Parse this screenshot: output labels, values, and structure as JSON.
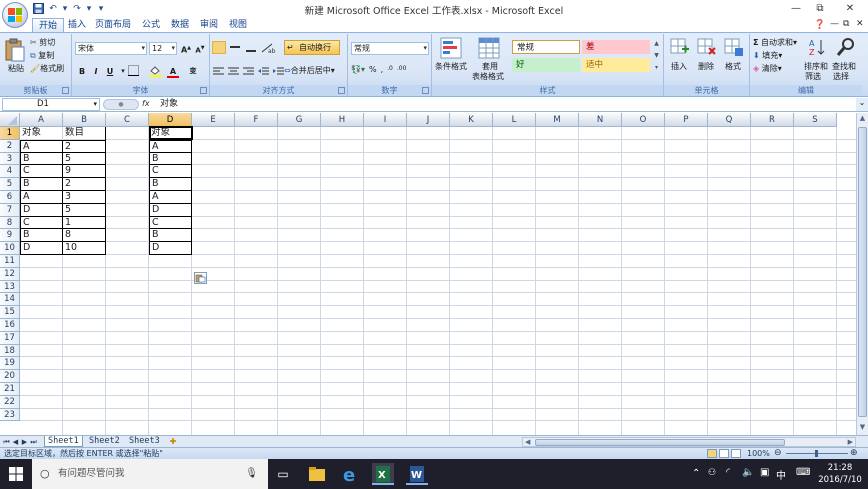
{
  "window": {
    "title": "新建 Microsoft Office Excel 工作表.xlsx - Microsoft Excel",
    "controls": [
      "—",
      "⧉",
      "✕"
    ]
  },
  "qat": {
    "save_icon": "save-icon",
    "undo": "↶",
    "redo": "↷"
  },
  "tabs": [
    "开始",
    "插入",
    "页面布局",
    "公式",
    "数据",
    "审阅",
    "视图"
  ],
  "ribbon": {
    "clipboard": {
      "label": "剪贴板",
      "paste": "粘贴",
      "cut": "剪切",
      "copy": "复制",
      "format_painter": "格式刷"
    },
    "font": {
      "label": "字体",
      "name": "宋体",
      "size": "12",
      "grow": "A",
      "shrink": "A",
      "bold": "B",
      "italic": "I",
      "underline": "U"
    },
    "alignment": {
      "label": "对齐方式",
      "wrap": "自动换行",
      "merge": "合并后居中"
    },
    "number": {
      "label": "数字",
      "format": "常规",
      "percent": "%",
      "comma": ",",
      "inc": ".0",
      "dec": ".00"
    },
    "styles": {
      "label": "样式",
      "conditional": "条件格式",
      "table": "套用",
      "table2": "表格格式",
      "normal": "常规",
      "bad": "差",
      "good": "好",
      "neutral": "适中"
    },
    "cells": {
      "label": "单元格",
      "insert": "插入",
      "delete": "删除",
      "format": "格式"
    },
    "editing": {
      "label": "编辑",
      "autosum": "自动求和",
      "fill": "填充",
      "clear": "清除",
      "sort": "排序和",
      "sort2": "筛选",
      "find": "查找和",
      "find2": "选择"
    }
  },
  "formula_bar": {
    "name_box": "D1",
    "fx": "fx",
    "content": "对象"
  },
  "columns": [
    "A",
    "B",
    "C",
    "D",
    "E",
    "F",
    "G",
    "H",
    "I",
    "J",
    "K",
    "L",
    "M",
    "N",
    "O",
    "P",
    "Q",
    "R",
    "S"
  ],
  "rows": [
    "1",
    "2",
    "3",
    "4",
    "5",
    "6",
    "7",
    "8",
    "9",
    "10",
    "11",
    "12",
    "13",
    "14",
    "15",
    "16",
    "17",
    "18",
    "19",
    "20",
    "21",
    "22",
    "23"
  ],
  "cells": {
    "A": [
      "对象",
      "A",
      "B",
      "C",
      "B",
      "A",
      "D",
      "C",
      "B",
      "D"
    ],
    "B": [
      "数目",
      "2",
      "5",
      "9",
      "2",
      "3",
      "5",
      "1",
      "8",
      "10"
    ],
    "D": [
      "对象",
      "A",
      "B",
      "C",
      "B",
      "A",
      "D",
      "C",
      "B",
      "D"
    ]
  },
  "sheets": [
    "Sheet1",
    "Sheet2",
    "Sheet3"
  ],
  "status": {
    "message": "选定目标区域，然后按 ENTER 或选择\"粘贴\"",
    "zoom": "100%"
  },
  "taskbar": {
    "search_placeholder": "有问题尽管问我",
    "time": "21:28",
    "date": "2016/7/10",
    "ime": "中"
  }
}
